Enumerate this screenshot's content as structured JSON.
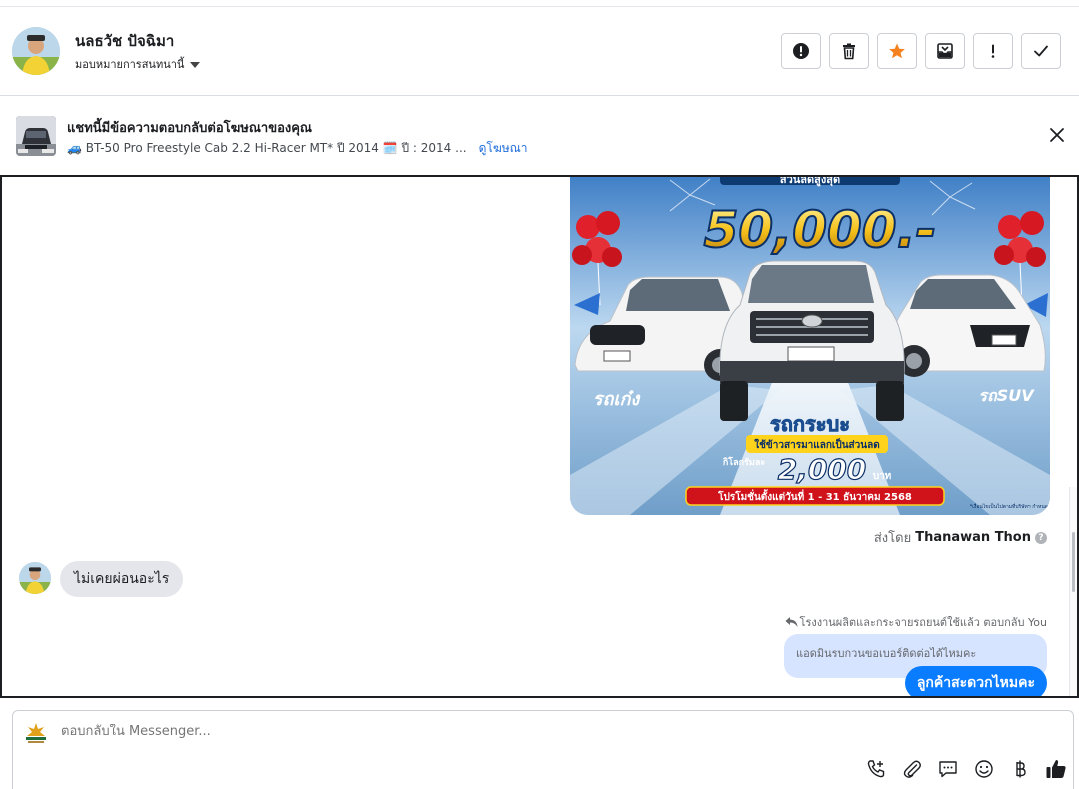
{
  "contact": {
    "name": "นลธวัช ปัจฉิมา",
    "assign_label": "มอบหมายการสนทนานี้"
  },
  "header_actions": [
    {
      "name": "spam-button",
      "icon": "alert-circle-icon"
    },
    {
      "name": "delete-button",
      "icon": "trash-icon"
    },
    {
      "name": "star-button",
      "icon": "star-icon",
      "color": "#f5821f"
    },
    {
      "name": "archive-button",
      "icon": "archive-icon"
    },
    {
      "name": "follow-up-button",
      "icon": "exclamation-icon"
    },
    {
      "name": "done-button",
      "icon": "check-icon"
    }
  ],
  "ad_banner": {
    "title": "แชทนี้มีข้อความตอบกลับต่อโฆษณาของคุณ",
    "subtitle": "🚙 BT-50 Pro Freestyle Cab 2.2 Hi-Racer MT* ปี 2014 🗓️ ปี : 2014 ...",
    "link": "ดูโฆษณา"
  },
  "promo_image": {
    "headline": "50,000.-",
    "top_text": "ส่วนลดสูงสุด",
    "left_label": "รถเก๋ง",
    "right_label": "รถSUV",
    "center_label": "รถกระบะ",
    "trade_text": "ใช้ข้าวสารมาแลกเป็นส่วนลด",
    "per_kg": "กิโลกรัมละ",
    "price": "2,000",
    "price_unit": "บาท",
    "period": "โปรโมชั่นตั้งแต่วันที่ 1 - 31 ธันวาคม 2568",
    "fine_print": "*เงื่อนไขเป็นไปตามที่บริษัทฯ กำหนด"
  },
  "messages": {
    "sent_by_prefix": "ส่งโดย",
    "sent_by_name": "Thanawan Thon",
    "incoming_text": "ไม่เคยผ่อนอะไร",
    "reply_note": "โรงงานผลิตและกระจายรถยนต์ใช้แล้ว ตอบกลับ You",
    "quoted_text": "แอดมินรบกวนขอเบอร์ติดต่อได้ไหมคะ",
    "outgoing_text": "ลูกค้าสะดวกไหมคะ"
  },
  "composer": {
    "placeholder": "ตอบกลับใน Messenger..."
  },
  "colors": {
    "accent": "#0a7cff",
    "link": "#216fdb",
    "star": "#f5821f"
  }
}
